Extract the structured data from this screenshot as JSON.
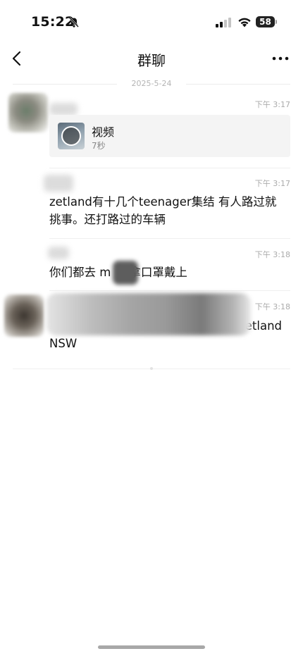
{
  "status_bar": {
    "time": "15:22",
    "battery": "58",
    "icons": [
      "bell-slash-icon",
      "signal-icon",
      "wifi-icon",
      "battery-icon"
    ]
  },
  "nav": {
    "title": "群聊",
    "back_icon": "chevron-left-icon",
    "more_icon": "more-dots-icon"
  },
  "date_divider": "2025-5-24",
  "messages": [
    {
      "time": "下午 3:17",
      "type": "video",
      "video_title": "视频",
      "video_duration": "7秒",
      "icon": "play-icon"
    },
    {
      "time": "下午 3:17",
      "type": "text",
      "lines": [
        "zetland有十几个teenager集结  有人路过就",
        "挑事。还打路过的车辆"
      ]
    },
    {
      "time": "下午 3:18",
      "type": "text",
      "prefix": "你们都去 m",
      "suffix": "拿口罩戴上"
    },
    {
      "time": "下午 3:18",
      "type": "text",
      "tail": "etland",
      "line2": "NSW"
    }
  ],
  "colors": {
    "background": "#ffffff",
    "card": "#f4f4f4",
    "timestamp": "#ababab",
    "divider": "#efefef"
  }
}
